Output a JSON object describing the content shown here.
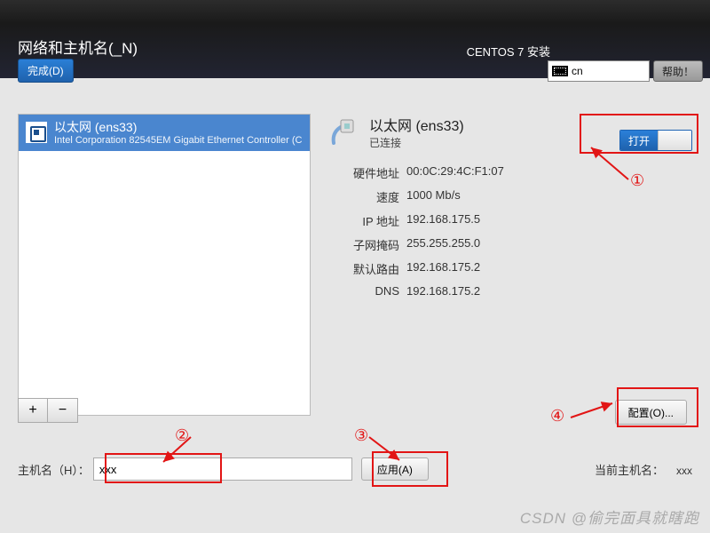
{
  "topbar": {
    "title": "网络和主机名(_N)",
    "done_label": "完成(D)",
    "right_text": "CENTOS 7 安装",
    "keyboard_layout": "cn",
    "help_label": "帮助！"
  },
  "device_list": {
    "items": [
      {
        "name": "以太网 (ens33)",
        "desc": "Intel Corporation 82545EM Gigabit Ethernet Controller (C"
      }
    ],
    "add_label": "+",
    "remove_label": "−"
  },
  "detail": {
    "title": "以太网 (ens33)",
    "status": "已连接",
    "toggle_on_label": "打开",
    "rows": {
      "hw_label": "硬件地址",
      "hw_val": "00:0C:29:4C:F1:07",
      "spd_label": "速度",
      "spd_val": "1000 Mb/s",
      "ip_label": "IP 地址",
      "ip_val": "192.168.175.5",
      "mask_label": "子网掩码",
      "mask_val": "255.255.255.0",
      "gw_label": "默认路由",
      "gw_val": "192.168.175.2",
      "dns_label": "DNS",
      "dns_val": "192.168.175.2"
    },
    "config_label": "配置(O)..."
  },
  "hostname": {
    "label": "主机名（H）：",
    "value": "xxx",
    "apply_label": "应用(A)",
    "current_label": "当前主机名：",
    "current_value": "xxx"
  },
  "annotations": {
    "n1": "①",
    "n2": "②",
    "n3": "③",
    "n4": "④"
  },
  "watermark": "CSDN @偷完面具就瞎跑"
}
